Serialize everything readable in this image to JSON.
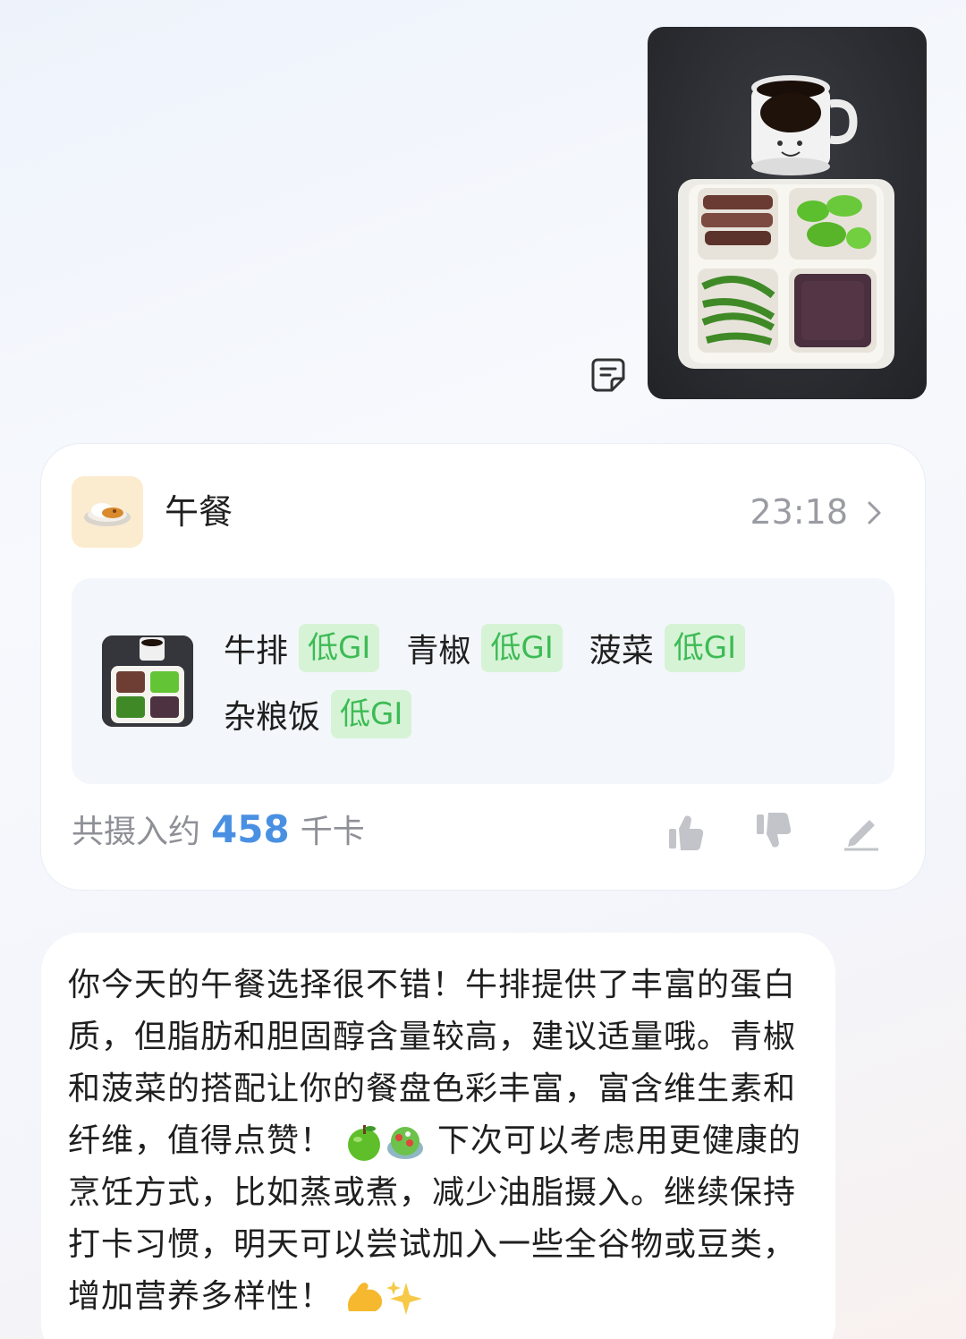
{
  "meal": {
    "title": "午餐",
    "time": "23:18",
    "foods": [
      {
        "name": "牛排",
        "badge": "低GI"
      },
      {
        "name": "青椒",
        "badge": "低GI"
      },
      {
        "name": "菠菜",
        "badge": "低GI"
      },
      {
        "name": "杂粮饭",
        "badge": "低GI"
      }
    ],
    "intake_prefix": "共摄入约",
    "intake_value": "458",
    "intake_unit": "千卡"
  },
  "reply": {
    "part1": "你今天的午餐选择很不错！牛排提供了丰富的蛋白质，但脂肪和胆固醇含量较高，建议适量哦。青椒和菠菜的搭配让你的餐盘色彩丰富，富含维生素和纤维，值得点赞！",
    "part2": " 下次可以考虑用更健康的烹饪方式，比如蒸或煮，减少油脂摄入。继续保持打卡习惯，明天可以尝试加入一些全谷物或豆类，增加营养多样性！"
  },
  "icons": {
    "note": "note-icon",
    "chevron": "chevron-right-icon",
    "like": "thumbs-up-icon",
    "dislike": "thumbs-down-icon",
    "edit": "pencil-icon",
    "emoji_1": "green-apple-emoji",
    "emoji_2": "salad-emoji",
    "emoji_3": "flexed-biceps-emoji",
    "emoji_4": "sparkles-emoji"
  },
  "colors": {
    "accent": "#4a90e2",
    "gi_badge_bg": "#d6f3d6",
    "gi_badge_text": "#3dbb55"
  }
}
